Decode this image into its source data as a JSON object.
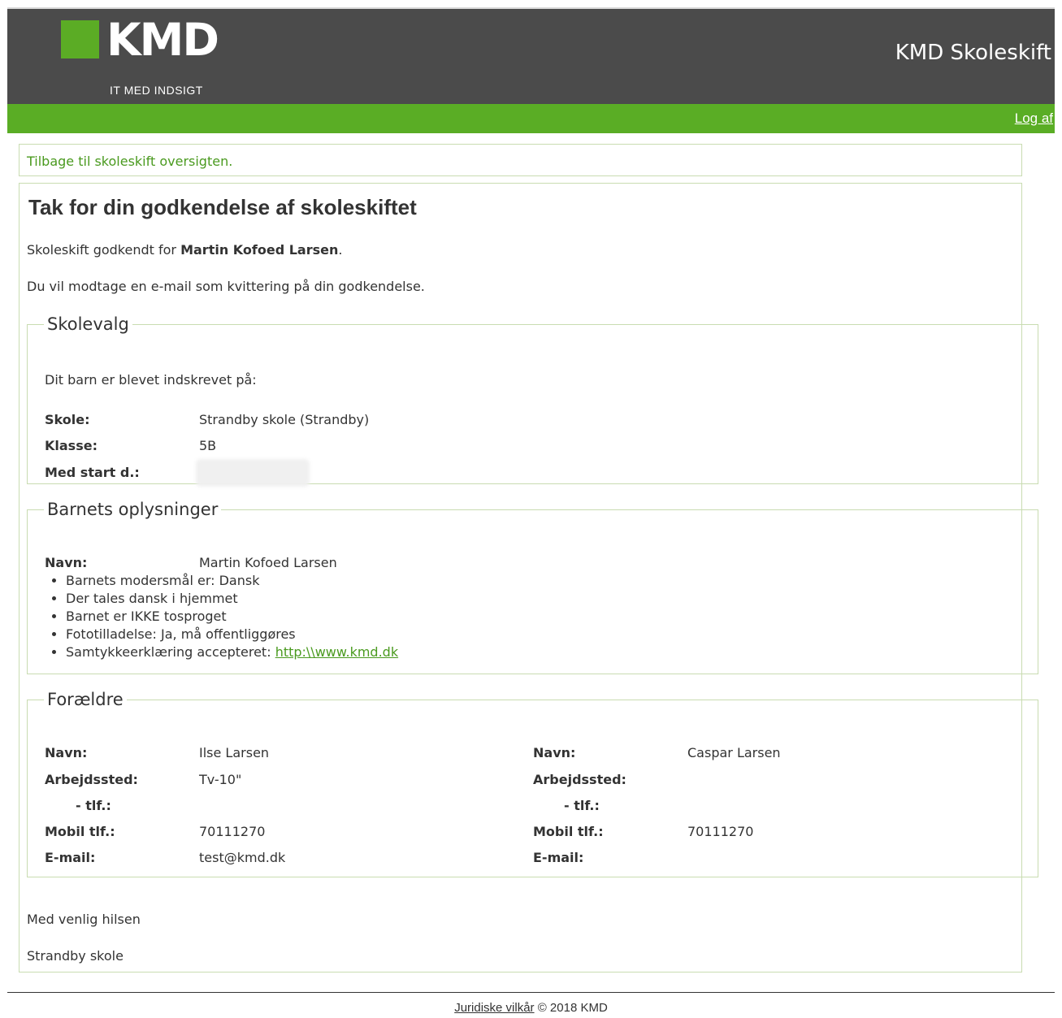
{
  "header": {
    "logo_word": "KMD",
    "logo_tagline": "IT MED INDSIGT",
    "app_title": "KMD Skoleskift",
    "logout": "Log af"
  },
  "nav": {
    "back_link": "Tilbage til skoleskift oversigten."
  },
  "main": {
    "title": "Tak for din godkendelse af skoleskiftet",
    "approved_prefix": "Skoleskift godkendt for ",
    "approved_name": "Martin Kofoed Larsen",
    "approved_suffix": ".",
    "receipt_text": "Du vil modtage en e-mail som kvittering på din godkendelse."
  },
  "skolevalg": {
    "legend": "Skolevalg",
    "intro": "Dit barn er blevet indskrevet på:",
    "school_label": "Skole:",
    "school_value": "Strandby skole (Strandby)",
    "class_label": "Klasse:",
    "class_value": "5B",
    "start_label": "Med start d.:"
  },
  "barn": {
    "legend": "Barnets oplysninger",
    "name_label": "Navn:",
    "name_value": "Martin Kofoed Larsen",
    "items": [
      "Barnets modersmål er: Dansk",
      "Der tales dansk i hjemmet",
      "Barnet er IKKE tosproget",
      "Fototilladelse: Ja, må offentliggøres"
    ],
    "consent_prefix": "Samtykkeerklæring accepteret: ",
    "consent_link": "http:\\\\www.kmd.dk"
  },
  "foraeldre": {
    "legend": "Forældre",
    "labels": {
      "name": "Navn:",
      "workplace": "Arbejdssted:",
      "phone": "- tlf.:",
      "mobile": "Mobil tlf.:",
      "email": "E-mail:"
    },
    "parent1": {
      "name": "Ilse Larsen",
      "workplace": "Tv-10\"",
      "phone": "",
      "mobile": "70111270",
      "email": "test@kmd.dk"
    },
    "parent2": {
      "name": "Caspar Larsen",
      "workplace": "",
      "phone": "",
      "mobile": "70111270",
      "email": ""
    }
  },
  "closing": {
    "greeting": "Med venlig hilsen",
    "signature": "Strandby skole"
  },
  "footer": {
    "terms_link": "Juridiske vilkår",
    "copyright": " © 2018 KMD"
  },
  "colors": {
    "brand_green": "#5aad25",
    "header_dark": "#4b4b4b",
    "link_green": "#4a9a1f",
    "border": "#c9dcb1"
  }
}
